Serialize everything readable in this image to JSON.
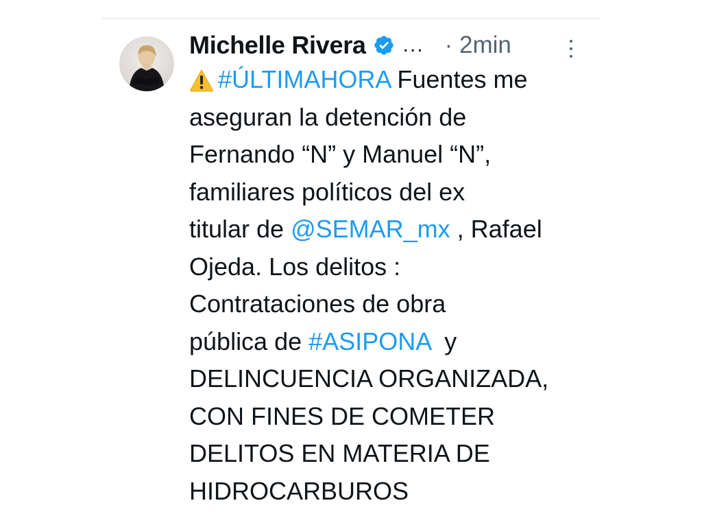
{
  "author": {
    "name": "Michelle Rivera",
    "truncation": "...",
    "timestamp": "· 2min"
  },
  "icons": {
    "avatar": "profile-photo",
    "verified": "verified-badge-icon",
    "more": "more-options-icon",
    "warning": "warning-emoji-icon"
  },
  "colors": {
    "link": "#1d9bf0",
    "text": "#0f1419",
    "muted": "#536471",
    "verified": "#1d9bf0",
    "warning": "#f7c02b"
  },
  "tweet": {
    "hashtag_ultimahora": "#ÚLTIMAHORA",
    "line1_rest": " Fuentes me",
    "line2": "aseguran la detención de",
    "line3": "Fernando “N” y Manuel “N”,",
    "line4": "familiares políticos del ex",
    "line5_pre": "titular de ",
    "mention_semar": "@SEMAR_mx",
    "line5_post": " , Rafael",
    "line6": "Ojeda. Los delitos :",
    "line7": "Contrataciones de obra",
    "line8_pre": "pública de ",
    "hashtag_asipona": "#ASIPONA",
    "line8_post": "  y",
    "line9": "DELINCUENCIA ORGANIZADA,",
    "line10": "CON FINES DE COMETER",
    "line11": "DELITOS EN MATERIA DE",
    "line12": "HIDROCARBUROS"
  }
}
